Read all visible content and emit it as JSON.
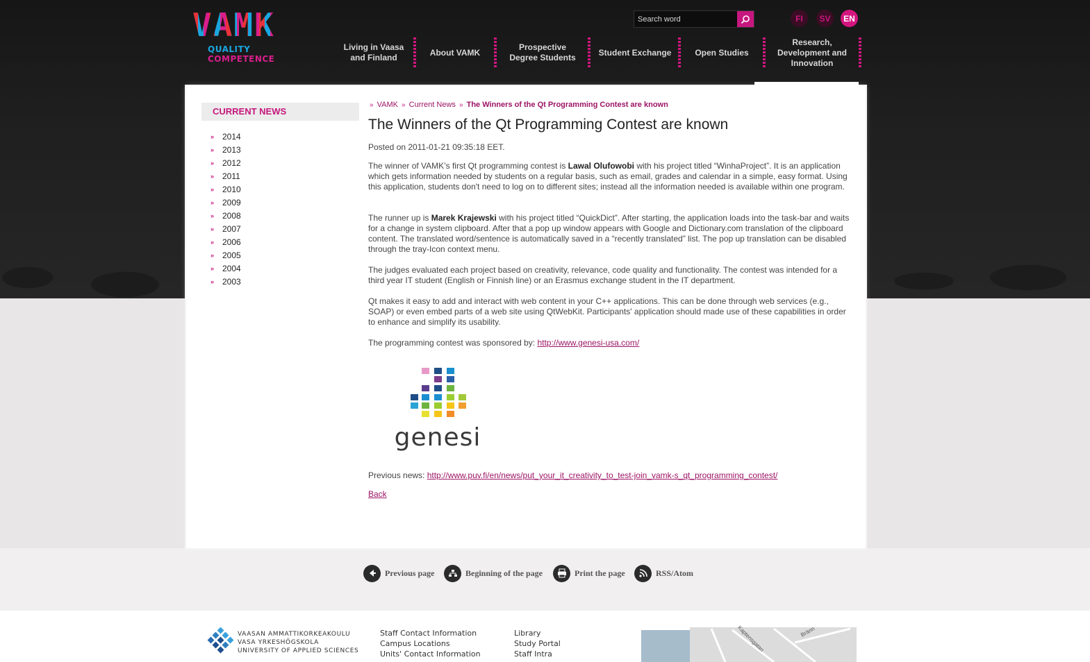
{
  "header": {
    "logo_text": "VAMK",
    "logo_tagline_1": "QUALITY",
    "logo_tagline_2": "COMPETENCE",
    "search_placeholder": "Search word",
    "languages": [
      "FI",
      "SV",
      "EN"
    ],
    "active_language": "EN",
    "nav": [
      "Living in Vaasa and Finland",
      "About VAMK",
      "Prospective Degree Students",
      "Student Exchange",
      "Open Studies",
      "Research, Development and Innovation"
    ]
  },
  "sidebar": {
    "heading": "CURRENT NEWS",
    "years": [
      "2014",
      "2013",
      "2012",
      "2011",
      "2010",
      "2009",
      "2008",
      "2007",
      "2006",
      "2005",
      "2004",
      "2003"
    ]
  },
  "breadcrumb": {
    "items": [
      "VAMK",
      "Current News"
    ],
    "current": "The Winners of the Qt Programming Contest are known"
  },
  "article": {
    "title": "The Winners of the Qt Programming Contest are known",
    "posted": "Posted on 2011-01-21 09:35:18 EET.",
    "p1_before": "The winner of VAMK’s first Qt programming contest is ",
    "p1_name": "Lawal Olufowobi",
    "p1_after": " with his project titled “WinhaProject”. It is an application which gets information needed by students on a regular basis, such as email, grades and calendar in a simple, easy format. Using this application, students don't need to log on to different sites; instead all the information needed is available within one program.",
    "p2_before": "The runner up is ",
    "p2_name": "Marek Krajewski",
    "p2_after": " with his project titled “QuickDict”. After starting, the application loads into the task-bar and waits for a change in system clipboard. After that a pop up window appears with Google and Dictionary.com translation of the clipboard content. The translated word/sentence is automatically saved in a “recently translated” list. The pop up translation can be disabled through the tray-Icon context menu.",
    "p3": "The judges evaluated each project based on creativity, relevance, code quality and functionality. The contest was intended for a third year IT student (English or Finnish line) or an Erasmus exchange student in the IT department.",
    "p4": "Qt makes it easy to add and interact with web content in your C++ applications. This can be done through web services (e.g., SOAP) or even embed parts of a web site using QtWebKit. Participants' application should made use of these capabilities in order to enhance and simplify its usability.",
    "sponsor_label": "The programming contest was sponsored by: ",
    "sponsor_link": "http://www.genesi-usa.com/",
    "sponsor_logo_text": "genesi",
    "previous_label": "Previous news: ",
    "previous_link": "http://www.puv.fi/en/news/put_your_it_creativity_to_test-join_vamk-s_qt_programming_contest/",
    "back": "Back"
  },
  "tools": [
    "Previous page",
    "Beginning of the page",
    "Print the page",
    "RSS/Atom"
  ],
  "footer": {
    "uni_lines": [
      "VAASAN AMMATTIKORKEAKOULU",
      "VASA YRKESHÖGSKOLA",
      "UNIVERSITY OF APPLIED SCIENCES"
    ],
    "col1": [
      "Staff Contact Information",
      "Campus Locations",
      "Units' Contact Information"
    ],
    "col2": [
      "Library",
      "Study Portal",
      "Staff Intra"
    ],
    "map_labels": [
      "Kaptensgatan",
      "Bränn"
    ]
  },
  "colors": {
    "accent": "#c7177f",
    "dark_bg": "#1f1f1f",
    "link": "#9c1464"
  }
}
